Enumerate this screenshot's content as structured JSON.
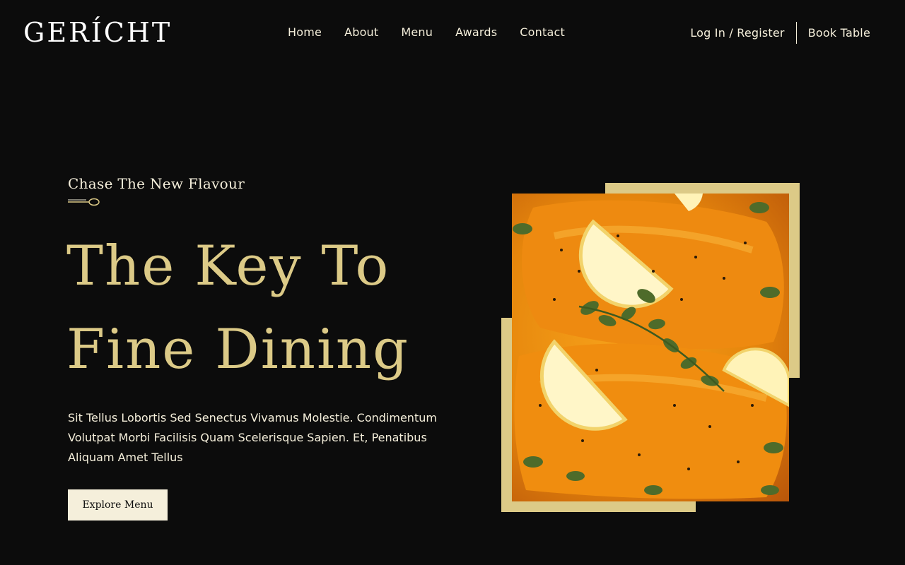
{
  "brand": {
    "logo": "GERÍCHT"
  },
  "nav": {
    "items": [
      {
        "label": "Home"
      },
      {
        "label": "About"
      },
      {
        "label": "Menu"
      },
      {
        "label": "Awards"
      },
      {
        "label": "Contact"
      }
    ]
  },
  "auth": {
    "login_label": "Log In / Register",
    "book_label": "Book Table"
  },
  "hero": {
    "subtitle": "Chase The New Flavour",
    "title_line1": "The Key To",
    "title_line2": "Fine Dining",
    "text": "Sit Tellus Lobortis Sed Senectus Vivamus Molestie. Condimentum Volutpat Morbi Facilisis Quam Scelerisque Sapien. Et, Penatibus Aliquam Amet Tellus",
    "cta_label": "Explore Menu"
  },
  "colors": {
    "background": "#0c0c0c",
    "gold": "#dcca87",
    "cream": "#f5efdb",
    "food_orange": "#f29a16"
  },
  "icons": {
    "divider": "spoon-icon"
  }
}
